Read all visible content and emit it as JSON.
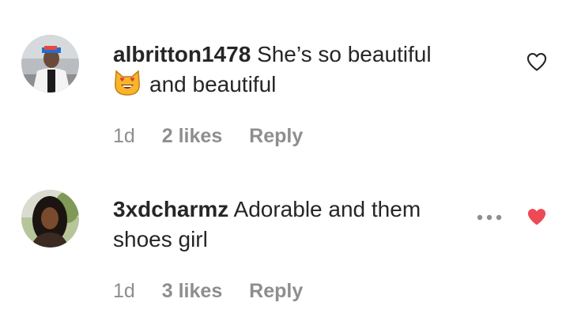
{
  "comments": [
    {
      "username": "albritton1478",
      "text_line1": "She’s so beautiful",
      "text_line2": "and beautiful",
      "emoji": "smiling-cat-heart-eyes",
      "time": "1d",
      "likes": "2 likes",
      "reply": "Reply",
      "liked": false,
      "heart_icon": "heart-outline-icon"
    },
    {
      "username": "3xdcharmz",
      "text_line1": "Adorable and them",
      "text_line2": "shoes girl",
      "time": "1d",
      "likes": "3 likes",
      "reply": "Reply",
      "liked": true,
      "heart_icon": "heart-filled-icon",
      "more_icon": "more-options-icon"
    }
  ],
  "colors": {
    "text": "#262626",
    "muted": "#8e8e8e",
    "liked_heart": "#ed4956"
  }
}
